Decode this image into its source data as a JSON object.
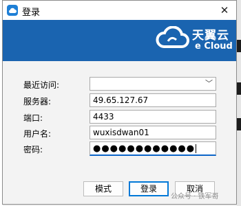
{
  "window": {
    "title": "登录",
    "close_label": "✕"
  },
  "banner": {
    "brand": "天翼云",
    "brand_sub": "e Cloud",
    "colors": {
      "background": "#1a64b0",
      "text": "#ffffff"
    }
  },
  "form": {
    "recent_label": "最近访问:",
    "recent_value": "",
    "server_label": "服务器:",
    "server_value": "49.65.127.67",
    "port_label": "端口:",
    "port_value": "4433",
    "username_label": "用户名:",
    "username_value": "wuxisdwan01",
    "password_label": "密码:",
    "password_mask": "●●●●●●●●●●●●"
  },
  "buttons": {
    "mode_label": "模式",
    "login_label": "登录",
    "cancel_label": "取消"
  },
  "watermark": {
    "text": "公众号 · 铁军哥"
  },
  "colors": {
    "accent": "#0078d7"
  }
}
